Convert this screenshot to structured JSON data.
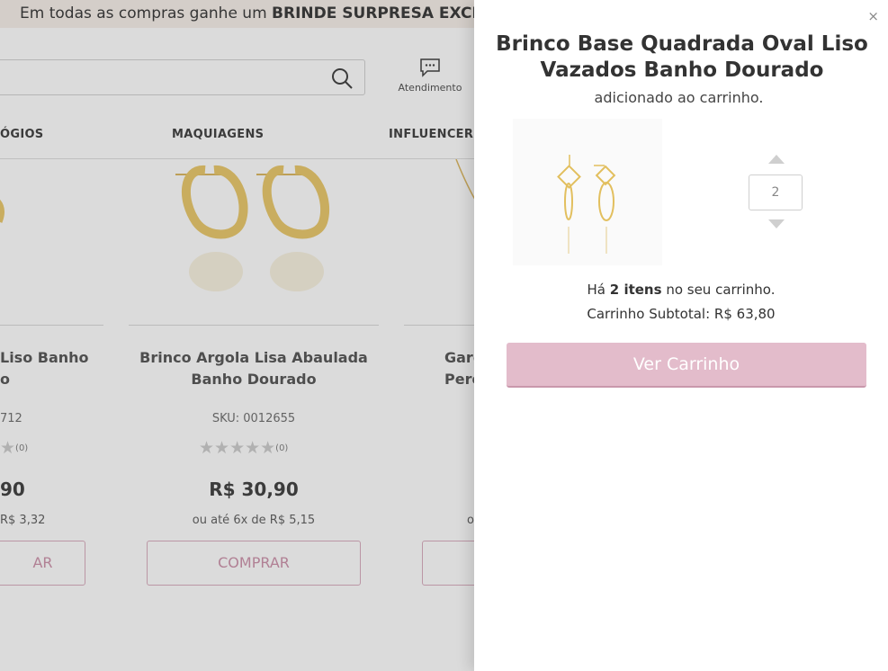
{
  "promo": {
    "text_plain": "Em todas as compras ganhe um ",
    "text_bold": "BRINDE SURPRESA EXCLU"
  },
  "header": {
    "help_label": "Atendimento"
  },
  "menu": {
    "items": [
      "ÓGIOS",
      "MAQUIAGENS",
      "INFLUENCERS"
    ]
  },
  "products": [
    {
      "name_line1": "Liso Banho",
      "name_line2": "o",
      "sku": "712",
      "rating_count": "(0)",
      "price": "90",
      "installments": "R$ 3,32",
      "buy_label": "AR"
    },
    {
      "name_line1": "Brinco Argola Lisa Abaulada",
      "name_line2": "Banho Dourado",
      "sku": "SKU: 0012655",
      "rating_count": "(0)",
      "price": "R$ 30,90",
      "installments": "ou até 6x de R$ 5,15",
      "buy_label": "COMPRAR"
    },
    {
      "name_line1": "Garg",
      "name_line2": "Pero",
      "installments": "ou"
    }
  ],
  "modal": {
    "close_label": "×",
    "title": "Brinco Base Quadrada Oval Liso Vazados Banho Dourado",
    "added_text": "adicionado ao carrinho.",
    "quantity": "2",
    "cart_prefix": "Há ",
    "cart_count": "2 itens",
    "cart_suffix": " no seu carrinho.",
    "subtotal": "Carrinho Subtotal: R$ 63,80",
    "view_cart_label": "Ver Carrinho"
  },
  "colors": {
    "accent_pink": "#e3bccb",
    "gold": "#e8c460"
  }
}
